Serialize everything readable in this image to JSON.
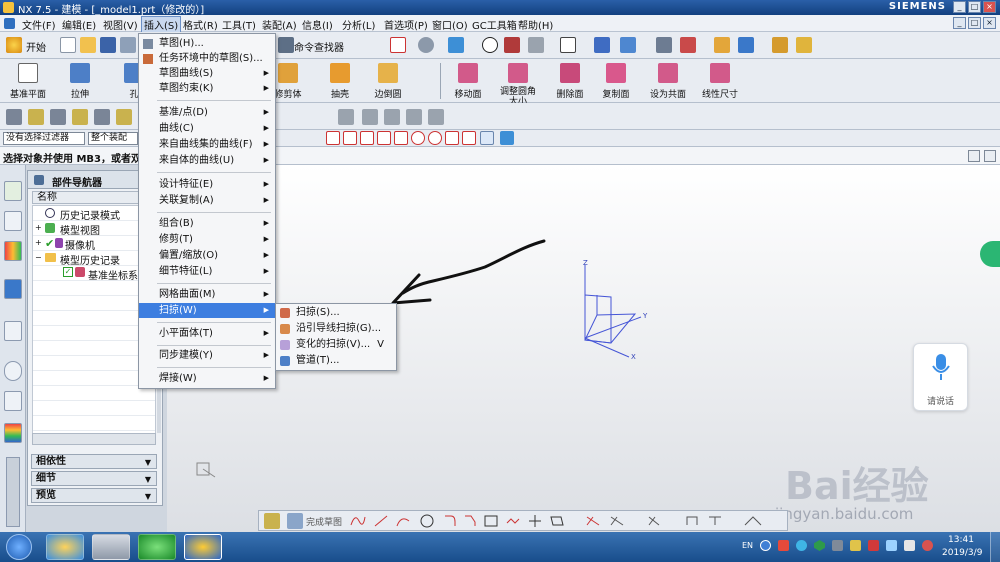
{
  "window": {
    "title": "NX 7.5 - 建模 - [_model1.prt（修改的）]",
    "brand": "SIEMENS",
    "controls": [
      "_",
      "□",
      "×"
    ]
  },
  "menubar": [
    "文件(F)",
    "编辑(E)",
    "视图(V)",
    "插入(S)",
    "格式(R)",
    "工具(T)",
    "装配(A)",
    "信息(I)",
    "分析(L)",
    "首选项(P)",
    "窗口(O)",
    "GC工具箱",
    "帮助(H)"
  ],
  "toolbar": {
    "start_label": "开始",
    "command_finder": "命令查找器",
    "feature_buttons": [
      "基准平面",
      "拉伸",
      "孔"
    ],
    "right_buttons": [
      "修剪体",
      "抽壳",
      "边倒圆",
      "移动面",
      "调整圆角大小",
      "删除面",
      "复制面",
      "设为共面",
      "线性尺寸"
    ],
    "selection_filter": "没有选择过滤器",
    "assembly_scope": "整个装配"
  },
  "statusline": "选择对象并使用 MB3，或者双击某一对象",
  "navigator": {
    "title": "部件导航器",
    "column_header": "名称",
    "items": [
      "历史记录模式",
      "模型视图",
      "摄像机",
      "模型历史记录",
      "基准坐标系 (0)"
    ],
    "sections": [
      "相依性",
      "细节",
      "预览"
    ]
  },
  "insert_menu": {
    "items": [
      "草图(H)...",
      "任务环境中的草图(S)...",
      "草图曲线(S)",
      "草图约束(K)",
      "基准/点(D)",
      "曲线(C)",
      "来自曲线集的曲线(F)",
      "来自体的曲线(U)",
      "设计特征(E)",
      "关联复制(A)",
      "组合(B)",
      "修剪(T)",
      "偏置/缩放(O)",
      "细节特征(L)",
      "网格曲面(M)",
      "扫掠(W)",
      "小平面体(T)",
      "同步建模(Y)",
      "焊接(W)"
    ],
    "highlighted": "扫掠(W)"
  },
  "sweep_submenu": {
    "items": [
      "扫掠(S)...",
      "沿引导线扫掠(G)...",
      "变化的扫掠(V)...",
      "管道(T)..."
    ],
    "shortcut": "V"
  },
  "sketch_toolbar": {
    "finish_label": "完成草图"
  },
  "canvas": {
    "axis_labels": [
      "Z",
      "Y",
      "X"
    ]
  },
  "voice_widget": {
    "label": "请说话"
  },
  "watermark": {
    "main": "Bai经验",
    "url": "jingyan.baidu.com"
  },
  "taskbar": {
    "lang": "EN",
    "time": "13:41",
    "date": "2019/3/9"
  }
}
